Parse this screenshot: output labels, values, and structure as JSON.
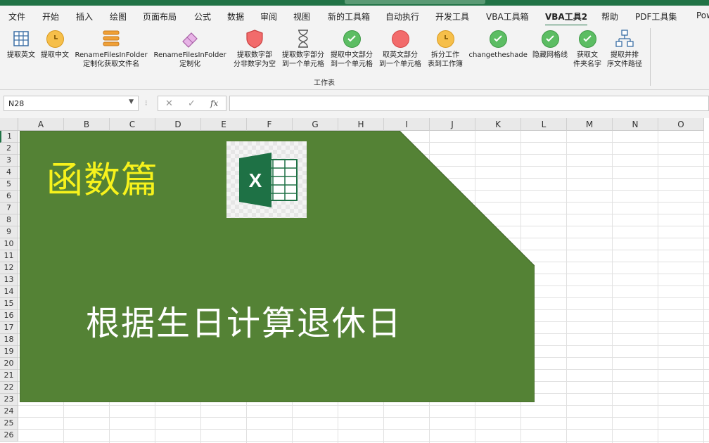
{
  "ribbon_tabs": [
    {
      "label": "文件"
    },
    {
      "label": "开始"
    },
    {
      "label": "插入"
    },
    {
      "label": "绘图"
    },
    {
      "label": "页面布局"
    },
    {
      "label": "公式"
    },
    {
      "label": "数据"
    },
    {
      "label": "审阅"
    },
    {
      "label": "视图"
    },
    {
      "label": "新的工具箱"
    },
    {
      "label": "自动执行"
    },
    {
      "label": "开发工具"
    },
    {
      "label": "VBA工具箱"
    },
    {
      "label": "VBA工具2",
      "active": true
    },
    {
      "label": "帮助"
    },
    {
      "label": "PDF工具集"
    },
    {
      "label": "Pow"
    }
  ],
  "ribbon_commands": [
    {
      "line1": "提取英文",
      "line2": "",
      "icon": "table-grid-icon"
    },
    {
      "line1": "提取中文",
      "line2": "",
      "icon": "clock-icon"
    },
    {
      "line1": "RenameFilesInFolder",
      "line2": "定制化获取文件名",
      "icon": "list-stack-icon"
    },
    {
      "line1": "RenameFilesInFolder",
      "line2": "定制化",
      "icon": "eraser-icon"
    },
    {
      "line1": "提取数字部",
      "line2": "分非数字为空",
      "icon": "shield-icon"
    },
    {
      "line1": "提取数字部分",
      "line2": "到一个单元格",
      "icon": "hourglass-icon"
    },
    {
      "line1": "提取中文部分",
      "line2": "到一个单元格",
      "icon": "check-circle-icon"
    },
    {
      "line1": "取英文部分",
      "line2": "到一个单元格",
      "icon": "red-circle-icon"
    },
    {
      "line1": "拆分工作",
      "line2": "表到工作簿",
      "icon": "clock-icon"
    },
    {
      "line1": "changetheshade",
      "line2": "",
      "icon": "check-circle-icon"
    },
    {
      "line1": "隐藏网格线",
      "line2": "",
      "icon": "check-circle-icon"
    },
    {
      "line1": "获取文",
      "line2": "件夹名字",
      "icon": "check-circle-icon"
    },
    {
      "line1": "提取并排",
      "line2": "序文件路径",
      "icon": "hierarchy-icon"
    }
  ],
  "ribbon_group_label": "工作表",
  "formula_bar": {
    "name_box": "N28",
    "cancel": "✕",
    "enter": "✓",
    "fx": "fx",
    "formula": ""
  },
  "columns": [
    "A",
    "B",
    "C",
    "D",
    "E",
    "F",
    "G",
    "H",
    "I",
    "J",
    "K",
    "L",
    "M",
    "N",
    "O"
  ],
  "rows": [
    "1",
    "2",
    "3",
    "4",
    "5",
    "6",
    "7",
    "8",
    "9",
    "10",
    "11",
    "12",
    "13",
    "14",
    "15",
    "16",
    "17",
    "18",
    "19",
    "20",
    "21",
    "22",
    "23",
    "24",
    "25",
    "26"
  ],
  "banner": {
    "title": "函数篇",
    "subtitle": "根据生日计算退休日",
    "logo_letter": "X",
    "colors": {
      "fill": "#548235",
      "title": "#f7f21c",
      "subtitle": "#ffffff"
    }
  }
}
